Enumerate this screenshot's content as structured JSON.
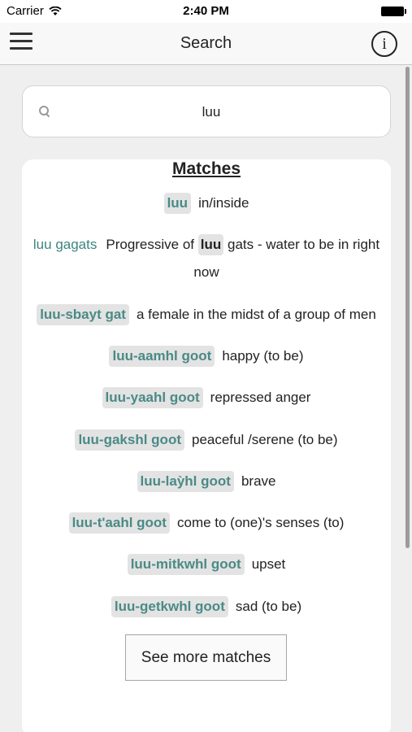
{
  "status_bar": {
    "carrier": "Carrier",
    "time": "2:40 PM",
    "wifi_icon": "wifi-icon",
    "battery_icon": "battery-icon"
  },
  "nav": {
    "title": "Search",
    "info_label": "i",
    "menu_icon": "hamburger-menu-icon"
  },
  "search": {
    "value": "luu",
    "placeholder": ""
  },
  "results": {
    "heading": "Matches",
    "entries": [
      {
        "term": "luu",
        "definition": "in/inside"
      },
      {
        "term": "luu gagats",
        "definition_prefix": "Progressive of",
        "definition_link": "luu",
        "definition_suffix": "gats - water to be in right now"
      },
      {
        "term": "luu-sbayt gat",
        "definition": "a female in the midst of a group of men"
      },
      {
        "term": "luu-aamhl goot",
        "definition": "happy (to be)"
      },
      {
        "term": "luu-yaahl goot",
        "definition": "repressed anger"
      },
      {
        "term": "luu-gakshl goot",
        "definition": "peaceful /serene (to be)"
      },
      {
        "term": "luu-laỳhl goot",
        "definition": "brave"
      },
      {
        "term": "luu-t'aahl goot",
        "definition": "come to (one)'s senses (to)"
      },
      {
        "term": "luu-mitkwhl goot",
        "definition": "upset"
      },
      {
        "term": "luu-getkwhl goot",
        "definition": "sad (to be)"
      }
    ],
    "more_button": "See more matches"
  },
  "colors": {
    "term": "#4a8a86",
    "chip_bg": "#e3e3e3",
    "background": "#efefef"
  }
}
